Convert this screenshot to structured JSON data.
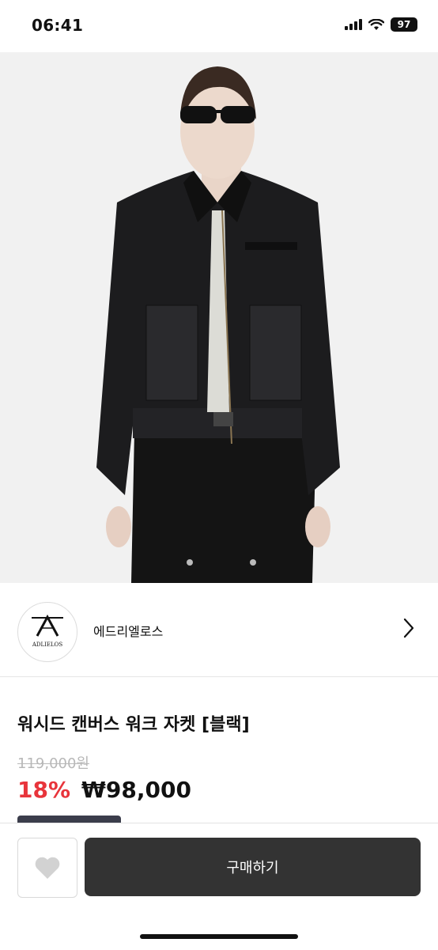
{
  "status_bar": {
    "time": "06:41",
    "battery": "97",
    "icons": [
      "signal-icon",
      "wifi-icon",
      "battery-icon"
    ]
  },
  "product_image": {
    "icon": "jacket-photo",
    "description_colors": {
      "background": "#f1f1f1",
      "jacket": "#1c1c1e"
    }
  },
  "shop": {
    "name": "에드리엘로스",
    "logo_text": "ADLIELOS",
    "logo_mark": "A"
  },
  "product": {
    "title": "워시드 캔버스 워크 자켓 [블랙]",
    "original_price": "119,000원",
    "discount": "18%",
    "price": "₩98,000"
  },
  "actions": {
    "buy_label": "구매하기",
    "like_icon": "heart-icon"
  },
  "colors": {
    "accent_discount": "#e8343b",
    "buy_button": "#333333",
    "badge": "#3b3d4b"
  }
}
